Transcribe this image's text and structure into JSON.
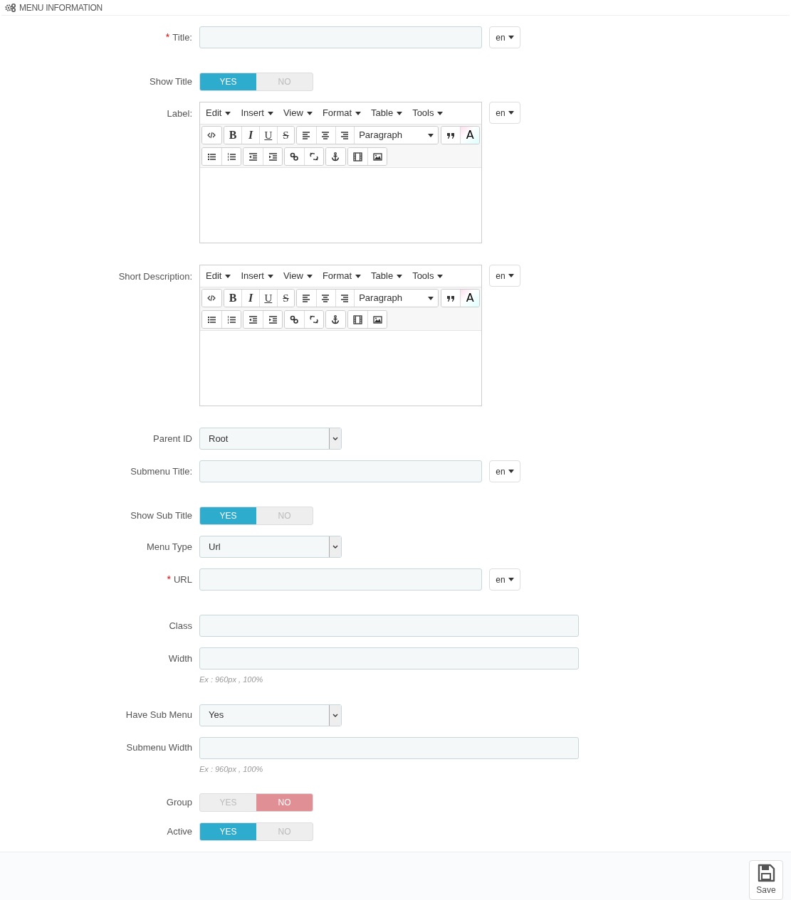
{
  "panel": {
    "title": "MENU INFORMATION"
  },
  "fields": [
    {
      "kind": "text",
      "label": "Title:",
      "required_mark": "*",
      "lang": "en"
    },
    {
      "kind": "switch",
      "label": "Show Title",
      "yes": "YES",
      "no": "NO",
      "on": true
    },
    {
      "kind": "editor",
      "label": "Label:",
      "lang": "en",
      "menus": [
        "Edit",
        "Insert",
        "View",
        "Format",
        "Table",
        "Tools"
      ],
      "format_buttons": [
        "B",
        "I",
        "U",
        "S"
      ],
      "block_format": "Paragraph",
      "color_button": "A"
    },
    {
      "kind": "editor",
      "label": "Short Description:",
      "lang": "en",
      "menus": [
        "Edit",
        "Insert",
        "View",
        "Format",
        "Table",
        "Tools"
      ],
      "format_buttons": [
        "B",
        "I",
        "U",
        "S"
      ],
      "block_format": "Paragraph",
      "color_button": "A"
    },
    {
      "kind": "select",
      "label": "Parent ID",
      "value": "Root"
    },
    {
      "kind": "text",
      "label": "Submenu Title:",
      "lang": "en"
    },
    {
      "kind": "switch",
      "label": "Show Sub Title",
      "yes": "YES",
      "no": "NO",
      "on": true
    },
    {
      "kind": "select",
      "label": "Menu Type",
      "value": "Url"
    },
    {
      "kind": "text",
      "label": "URL",
      "required_mark": "*",
      "lang": "en"
    },
    {
      "kind": "wide",
      "label": "Class"
    },
    {
      "kind": "wide",
      "label": "Width",
      "hint": "Ex : 960px , 100%"
    },
    {
      "kind": "select",
      "label": "Have Sub Menu",
      "value": "Yes"
    },
    {
      "kind": "wide",
      "label": "Submenu Width",
      "hint": "Ex : 960px , 100%"
    },
    {
      "kind": "switch",
      "label": "Group",
      "yes": "YES",
      "no": "NO",
      "on": false
    },
    {
      "kind": "switch",
      "label": "Active",
      "yes": "YES",
      "no": "NO",
      "on": true
    }
  ],
  "footer": {
    "save": "Save"
  }
}
